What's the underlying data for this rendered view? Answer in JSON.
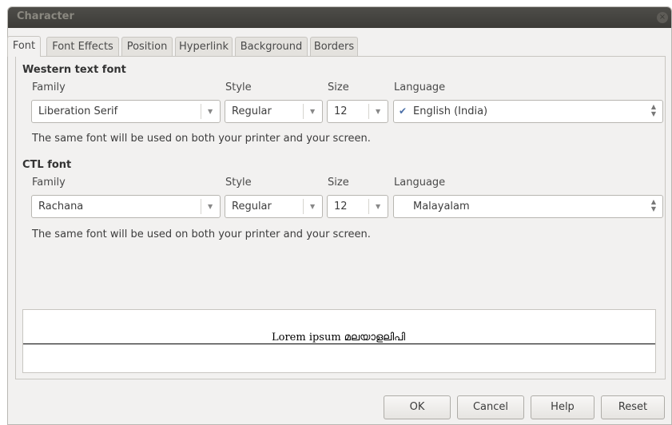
{
  "window": {
    "title": "Character",
    "close_glyph": "×"
  },
  "tabs": [
    "Font",
    "Font Effects",
    "Position",
    "Hyperlink",
    "Background",
    "Borders"
  ],
  "active_tab": "Font",
  "labels": {
    "family": "Family",
    "style": "Style",
    "size": "Size",
    "language": "Language"
  },
  "western": {
    "heading": "Western text font",
    "family": "Liberation Serif",
    "style": "Regular",
    "size": "12",
    "language": "English (India)",
    "language_icon": "spellcheck-icon",
    "note": "The same font will be used on both your printer and your screen."
  },
  "ctl": {
    "heading": "CTL font",
    "family": "Rachana",
    "style": "Regular",
    "size": "12",
    "language": "Malayalam",
    "note": "The same font will be used on both your printer and your screen."
  },
  "preview": {
    "text": "Lorem ipsum  മലയാളലിപി"
  },
  "buttons": {
    "ok": "OK",
    "cancel": "Cancel",
    "help": "Help",
    "reset": "Reset"
  },
  "colors": {
    "titlebar": "#3c3b37",
    "dialog_bg": "#f2f1f0"
  }
}
